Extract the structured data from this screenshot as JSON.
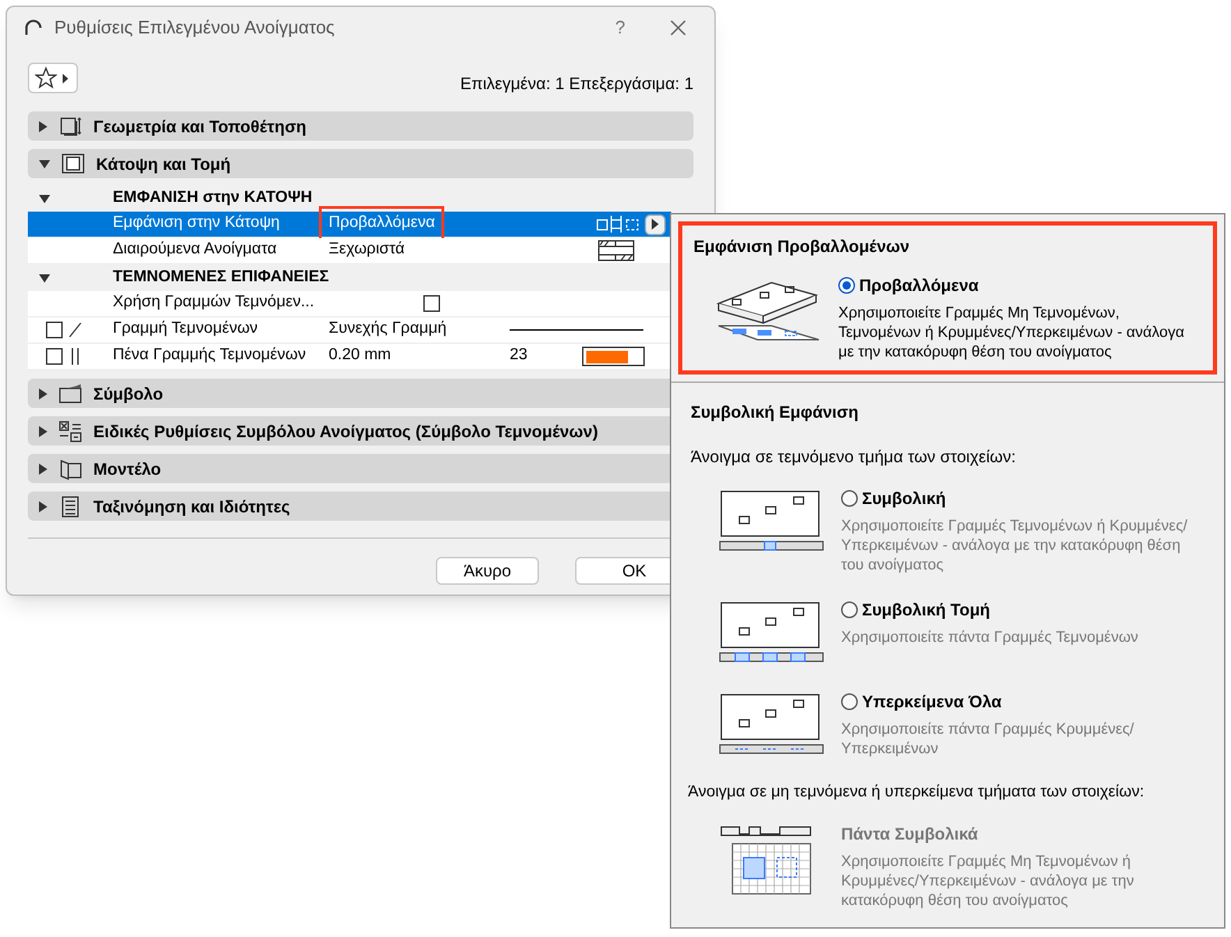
{
  "window": {
    "title": "Ρυθμίσεις Επιλεγμένου Ανοίγματος",
    "help": "?"
  },
  "selection_info": "Επιλεγμένα: 1 Επεξεργάσιμα: 1",
  "panels_top": [
    {
      "label": "Γεωμετρία και Τοποθέτηση",
      "expanded": false
    },
    {
      "label": "Κάτοψη και Τομή",
      "expanded": true
    }
  ],
  "rows": [
    {
      "kind": "group",
      "label": "ΕΜΦΑΝΙΣΗ στην ΚΑΤΟΨΗ",
      "expanded": true
    },
    {
      "kind": "value",
      "label": "Εμφάνιση στην Κάτοψη",
      "value": "Προβαλλόμενα",
      "selected": true,
      "callout": true
    },
    {
      "kind": "value",
      "label": "Διαιρούμενα Ανοίγματα",
      "value": "Ξεχωριστά",
      "selected": false,
      "callout": false
    },
    {
      "kind": "group",
      "label": "ΤΕΜΝΟΜΕΝΕΣ ΕΠΙΦΑΝΕΙΕΣ",
      "expanded": true
    },
    {
      "kind": "check",
      "label": "Χρήση Γραμμών Τεμνόμεν...",
      "checked": false
    },
    {
      "kind": "line",
      "label": "Γραμμή Τεμνομένων",
      "value": "Συνεχής Γραμμή",
      "checked": false
    },
    {
      "kind": "pen",
      "label": "Πένα Γραμμής Τεμνομένων",
      "value": "0.20 mm",
      "number": "23",
      "checked": false,
      "color": "#ff6a00"
    }
  ],
  "panels_bottom": [
    {
      "label": "Σύμβολο",
      "expanded": false
    },
    {
      "label": "Ειδικές Ρυθμίσεις Συμβόλου Ανοίγματος (Σύμβολο Τεμνομένων)",
      "expanded": false
    },
    {
      "label": "Μοντέλο",
      "expanded": false
    },
    {
      "label": "Ταξινόμηση και Ιδιότητες",
      "expanded": false
    }
  ],
  "buttons": [
    "Άκυρο",
    "OK"
  ],
  "popup": {
    "sections": [
      {
        "title": "Εμφάνιση Προβαλλομένων",
        "callout": true,
        "items": [
          {
            "kind": "radio",
            "label": "Προβαλλόμενα",
            "selected": true,
            "description": "Χρησιμοποιείτε Γραμμές Μη Τεμνομένων, Τεμνομένων ή Κρυμμένες/Υπερκειμένων - ανάλογα με την κατακόρυφη θέση του ανοίγματος"
          }
        ]
      },
      {
        "title": "Συμβολική Εμφάνιση",
        "callout": false,
        "subtitle": "Άνοιγμα σε τεμνόμενο τμήμα των στοιχείων:",
        "items": [
          {
            "kind": "radio",
            "label": "Συμβολική",
            "selected": false,
            "description": "Χρησιμοποιείτε Γραμμές Τεμνομένων ή Κρυμμένες/Υπερκειμένων - ανάλογα με την κατακόρυφη θέση του ανοίγματος"
          },
          {
            "kind": "radio",
            "label": "Συμβολική Τομή",
            "selected": false,
            "description": "Χρησιμοποιείτε πάντα Γραμμές Τεμνομένων"
          },
          {
            "kind": "radio",
            "label": "Υπερκείμενα Όλα",
            "selected": false,
            "description": "Χρησιμοποιείτε πάντα Γραμμές Κρυμμένες/Υπερκειμένων"
          }
        ],
        "subtitle2": "Άνοιγμα σε μη τεμνόμενα ή υπερκείμενα τμήματα των στοιχείων:",
        "items2": [
          {
            "kind": "fixed",
            "label": "Πάντα Συμβολικά",
            "description": "Χρησιμοποιείτε Γραμμές Μη Τεμνομένων ή Κρυμμένες/Υπερκειμένων - ανάλογα με την κατακόρυφη θέση του ανοίγματος"
          }
        ]
      }
    ]
  }
}
